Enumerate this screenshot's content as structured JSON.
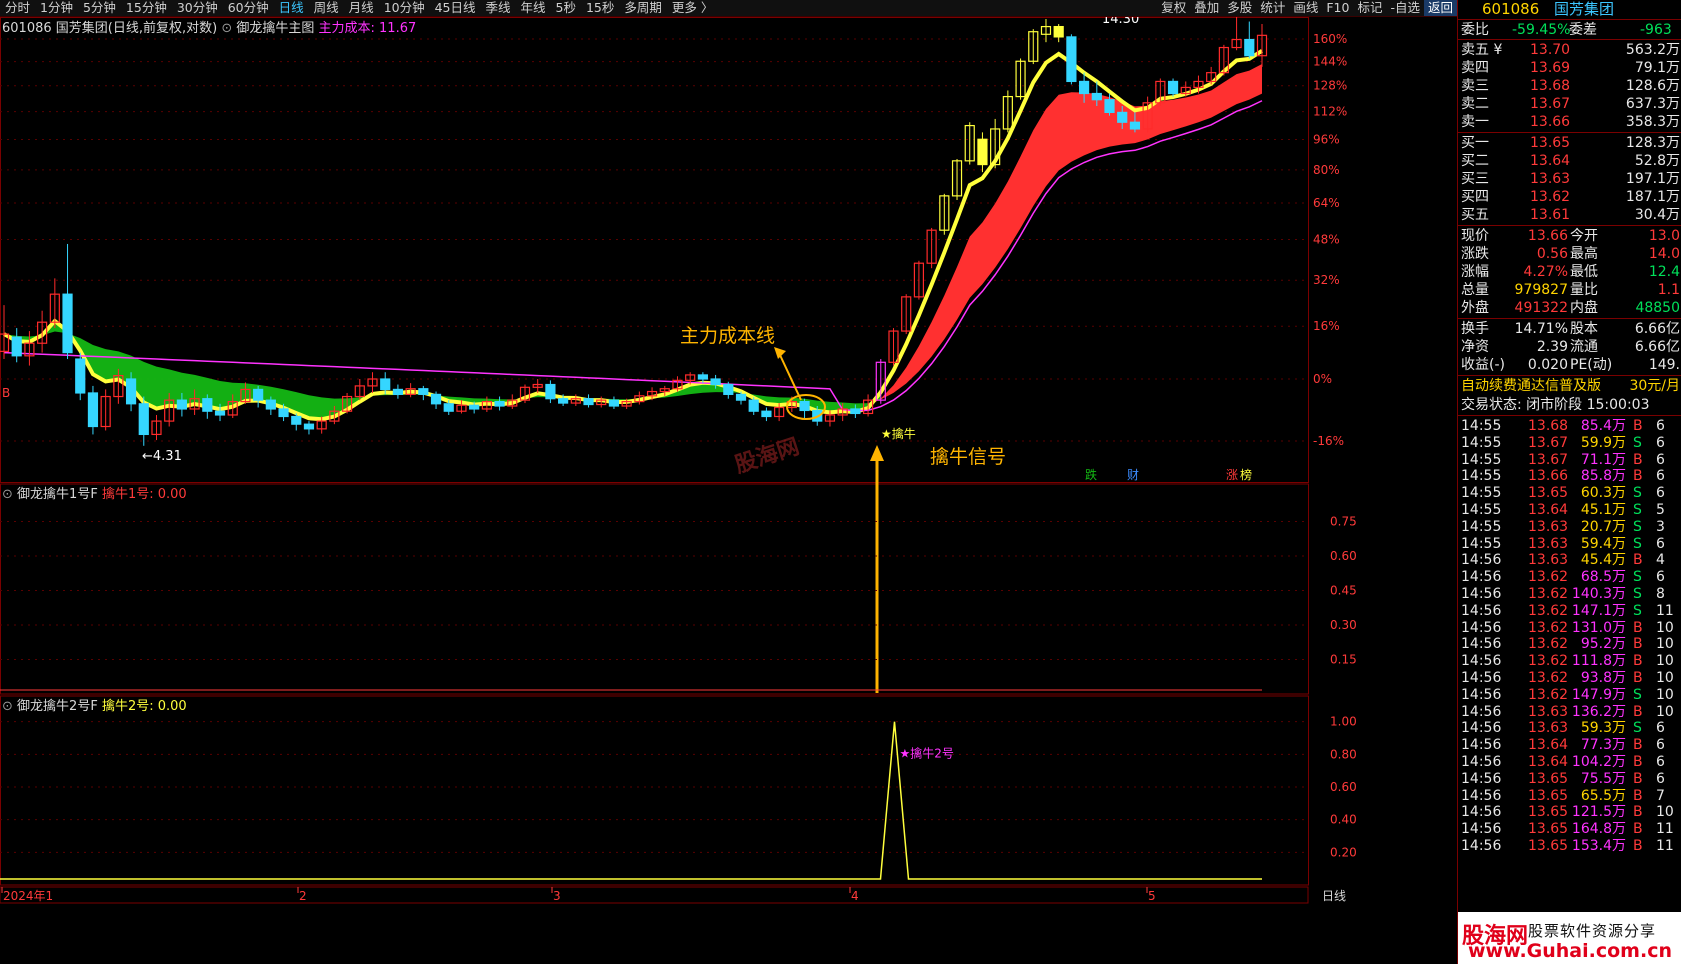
{
  "periods": [
    "分时",
    "1分钟",
    "5分钟",
    "15分钟",
    "30分钟",
    "60分钟",
    "日线",
    "周线",
    "月线",
    "10分钟",
    "45日线",
    "季线",
    "年线",
    "5秒",
    "15秒",
    "多周期",
    "更多 〉"
  ],
  "active_period": "日线",
  "tools": [
    "复权",
    "叠加",
    "多股",
    "统计",
    "画线",
    "F10",
    "标记",
    "-自选",
    "返回"
  ],
  "main_title": "601086 国芳集团(日线,前复权,对数)",
  "main_indicator": "御龙擒牛主图",
  "main_value": "主力成本: 11.67",
  "panel1_title": "御龙擒牛1号F",
  "panel1_value": "擒牛1号: 0.00",
  "panel2_title": "御龙擒牛2号F",
  "panel2_value": "擒牛2号: 0.00",
  "annotations": {
    "cost_line": "主力成本线",
    "signal": "擒牛信号",
    "qinniu": "★擒牛",
    "qinniu2": "★擒牛2号",
    "high": "14.30",
    "low": "4.31",
    "b_mark": "B",
    "watermark": "股海网",
    "die": "跌",
    "cai": "财",
    "zhang": "涨",
    "bang": "榜"
  },
  "x_axis": {
    "labels": [
      "2024年1",
      "2",
      "3",
      "4",
      "5"
    ],
    "period_label": "日线"
  },
  "colors": {
    "up": "#ff2b2b",
    "down": "#35d6ff",
    "yellow": "#ffff3c",
    "green": "#14b814",
    "magenta": "#ff33ff",
    "gold": "#ffb400"
  },
  "chart_data": [
    {
      "type": "candlestick",
      "title": "御龙擒牛主图",
      "y_scale": "log-percent",
      "y_ticks": [
        "160%",
        "144%",
        "128%",
        "112%",
        "96%",
        "80%",
        "64%",
        "48%",
        "32%",
        "16%",
        "0%",
        "-16%"
      ],
      "candles": [
        [
          0,
          5.62,
          5.9,
          6.4,
          5.5
        ],
        [
          1,
          5.85,
          5.55,
          6.0,
          5.45
        ],
        [
          2,
          5.55,
          5.75,
          5.95,
          5.4
        ],
        [
          3,
          5.75,
          6.1,
          6.3,
          5.6
        ],
        [
          4,
          6.1,
          6.6,
          6.9,
          6.0
        ],
        [
          5,
          6.6,
          5.6,
          7.6,
          5.5
        ],
        [
          6,
          5.5,
          5.0,
          5.6,
          4.9
        ],
        [
          7,
          5.0,
          4.55,
          5.1,
          4.45
        ],
        [
          8,
          4.55,
          4.95,
          5.05,
          4.5
        ],
        [
          9,
          4.95,
          5.25,
          5.35,
          4.85
        ],
        [
          10,
          5.2,
          4.85,
          5.3,
          4.75
        ],
        [
          11,
          4.85,
          4.45,
          4.95,
          4.31
        ],
        [
          12,
          4.45,
          4.62,
          4.7,
          4.38
        ],
        [
          13,
          4.62,
          4.9,
          5.0,
          4.55
        ],
        [
          14,
          4.9,
          4.78,
          5.0,
          4.68
        ],
        [
          15,
          4.78,
          4.92,
          5.05,
          4.7
        ],
        [
          16,
          4.92,
          4.75,
          4.98,
          4.65
        ],
        [
          17,
          4.75,
          4.7,
          4.85,
          4.62
        ],
        [
          18,
          4.7,
          4.88,
          4.98,
          4.66
        ],
        [
          19,
          4.88,
          5.05,
          5.15,
          4.85
        ],
        [
          20,
          5.05,
          4.9,
          5.1,
          4.8
        ],
        [
          21,
          4.9,
          4.78,
          4.95,
          4.7
        ],
        [
          22,
          4.78,
          4.68,
          4.85,
          4.62
        ],
        [
          23,
          4.68,
          4.58,
          4.72,
          4.5
        ],
        [
          24,
          4.58,
          4.52,
          4.62,
          4.45
        ],
        [
          25,
          4.52,
          4.62,
          4.68,
          4.46
        ],
        [
          26,
          4.62,
          4.75,
          4.82,
          4.58
        ],
        [
          27,
          4.75,
          4.95,
          5.0,
          4.72
        ],
        [
          28,
          4.95,
          5.1,
          5.2,
          4.9
        ],
        [
          29,
          5.1,
          5.2,
          5.3,
          5.0
        ],
        [
          30,
          5.2,
          5.05,
          5.3,
          4.98
        ],
        [
          31,
          5.05,
          4.98,
          5.12,
          4.92
        ],
        [
          32,
          4.98,
          5.06,
          5.14,
          4.94
        ],
        [
          33,
          5.06,
          4.98,
          5.1,
          4.9
        ],
        [
          34,
          4.98,
          4.85,
          5.02,
          4.78
        ],
        [
          35,
          4.85,
          4.75,
          4.9,
          4.7
        ],
        [
          36,
          4.75,
          4.83,
          4.9,
          4.72
        ],
        [
          37,
          4.83,
          4.78,
          4.88,
          4.72
        ],
        [
          38,
          4.78,
          4.88,
          4.95,
          4.74
        ],
        [
          39,
          4.88,
          4.82,
          4.95,
          4.76
        ],
        [
          40,
          4.82,
          4.9,
          4.98,
          4.78
        ],
        [
          41,
          4.9,
          5.08,
          5.12,
          4.86
        ],
        [
          42,
          5.08,
          5.12,
          5.2,
          5.0
        ],
        [
          43,
          5.12,
          4.92,
          5.18,
          4.86
        ],
        [
          44,
          4.92,
          4.86,
          4.98,
          4.82
        ],
        [
          45,
          4.86,
          4.92,
          4.98,
          4.82
        ],
        [
          46,
          4.92,
          4.84,
          4.98,
          4.8
        ],
        [
          47,
          4.84,
          4.9,
          4.95,
          4.8
        ],
        [
          48,
          4.9,
          4.82,
          4.95,
          4.78
        ],
        [
          49,
          4.82,
          4.88,
          4.92,
          4.78
        ],
        [
          50,
          4.88,
          4.96,
          5.02,
          4.84
        ],
        [
          51,
          4.96,
          5.02,
          5.08,
          4.9
        ],
        [
          52,
          5.02,
          5.06,
          5.1,
          4.96
        ],
        [
          53,
          5.06,
          5.18,
          5.24,
          5.02
        ],
        [
          54,
          5.18,
          5.26,
          5.3,
          5.12
        ],
        [
          55,
          5.26,
          5.2,
          5.3,
          5.14
        ],
        [
          56,
          5.2,
          5.12,
          5.26,
          5.06
        ],
        [
          57,
          5.12,
          4.98,
          5.16,
          4.92
        ],
        [
          58,
          4.98,
          4.9,
          5.02,
          4.84
        ],
        [
          59,
          4.9,
          4.75,
          4.94,
          4.7
        ],
        [
          60,
          4.75,
          4.68,
          4.8,
          4.62
        ],
        [
          61,
          4.68,
          4.8,
          4.86,
          4.62
        ],
        [
          62,
          4.8,
          4.88,
          4.95,
          4.74
        ],
        [
          63,
          4.88,
          4.76,
          4.92,
          4.66
        ],
        [
          64,
          4.76,
          4.62,
          4.82,
          4.56
        ],
        [
          65,
          4.62,
          4.7,
          4.76,
          4.55
        ],
        [
          66,
          4.7,
          4.78,
          4.86,
          4.62
        ],
        [
          67,
          4.78,
          4.72,
          4.84,
          4.66
        ],
        [
          68,
          4.72,
          4.9,
          4.98,
          4.68
        ],
        [
          69,
          4.9,
          5.45,
          5.5,
          4.85
        ],
        [
          70,
          5.45,
          5.95,
          6.0,
          5.4
        ],
        [
          71,
          5.95,
          6.55,
          6.6,
          5.9
        ],
        [
          72,
          6.55,
          7.2,
          7.25,
          6.5
        ],
        [
          73,
          7.2,
          7.9,
          7.95,
          7.1
        ],
        [
          74,
          7.9,
          8.7,
          8.75,
          7.8
        ],
        [
          75,
          8.7,
          9.6,
          9.65,
          8.6
        ],
        [
          76,
          9.6,
          10.6,
          10.7,
          9.5
        ],
        [
          77,
          10.2,
          9.5,
          10.4,
          9.3
        ],
        [
          78,
          9.5,
          10.5,
          10.8,
          9.4
        ],
        [
          79,
          10.5,
          11.5,
          11.7,
          10.4
        ],
        [
          80,
          11.5,
          12.7,
          12.8,
          11.4
        ],
        [
          81,
          12.7,
          13.8,
          13.9,
          12.6
        ],
        [
          82,
          13.7,
          14.0,
          14.3,
          13.4
        ],
        [
          83,
          14.0,
          13.6,
          14.1,
          13.4
        ],
        [
          84,
          13.6,
          12.0,
          13.7,
          11.9
        ],
        [
          85,
          12.0,
          11.6,
          12.3,
          11.3
        ],
        [
          86,
          11.6,
          11.4,
          12.0,
          11.2
        ],
        [
          87,
          11.4,
          11.0,
          11.6,
          10.9
        ],
        [
          88,
          11.0,
          10.7,
          11.2,
          10.5
        ],
        [
          89,
          10.7,
          10.5,
          11.0,
          10.4
        ],
        [
          90,
          10.5,
          11.3,
          11.5,
          10.4
        ],
        [
          91,
          11.3,
          12.0,
          12.1,
          11.2
        ],
        [
          92,
          12.0,
          11.6,
          12.1,
          11.5
        ],
        [
          93,
          11.6,
          11.8,
          12.0,
          11.5
        ],
        [
          94,
          11.8,
          12.0,
          12.2,
          11.6
        ],
        [
          95,
          12.0,
          12.3,
          12.5,
          11.9
        ],
        [
          96,
          12.3,
          13.2,
          13.3,
          12.2
        ],
        [
          97,
          13.2,
          13.5,
          14.8,
          13.1
        ],
        [
          98,
          13.5,
          12.9,
          14.2,
          12.8
        ],
        [
          99,
          12.9,
          13.66,
          14.1,
          12.5
        ]
      ],
      "series": [
        {
          "name": "主力成本",
          "color": "#ff33ff"
        }
      ]
    },
    {
      "type": "line",
      "title": "御龙擒牛1号F",
      "y_ticks": [
        "0.75",
        "0.60",
        "0.45",
        "0.30",
        "0.15"
      ],
      "ylim": [
        0,
        0.9
      ],
      "values": []
    },
    {
      "type": "line",
      "title": "御龙擒牛2号F",
      "y_ticks": [
        "1.00",
        "0.80",
        "0.60",
        "0.40",
        "0.20"
      ],
      "ylim": [
        0,
        1.2
      ],
      "spike_index": 70,
      "spike_value": 1.0
    }
  ],
  "quote": {
    "code": "601086",
    "name": "国芳集团",
    "weibi_label": "委比",
    "weibi": "-59.45%",
    "weicha_label": "委差",
    "weicha": "-963",
    "sell": [
      {
        "label": "卖五 ¥",
        "price": "13.70",
        "vol": "563.2万"
      },
      {
        "label": "卖四",
        "price": "13.69",
        "vol": "79.1万"
      },
      {
        "label": "卖三",
        "price": "13.68",
        "vol": "128.6万"
      },
      {
        "label": "卖二",
        "price": "13.67",
        "vol": "637.3万"
      },
      {
        "label": "卖一",
        "price": "13.66",
        "vol": "358.3万"
      }
    ],
    "buy": [
      {
        "label": "买一",
        "price": "13.65",
        "vol": "128.3万"
      },
      {
        "label": "买二",
        "price": "13.64",
        "vol": "52.8万"
      },
      {
        "label": "买三",
        "price": "13.63",
        "vol": "197.1万"
      },
      {
        "label": "买四",
        "price": "13.62",
        "vol": "187.1万"
      },
      {
        "label": "买五",
        "price": "13.61",
        "vol": "30.4万"
      }
    ],
    "stats": [
      {
        "l1": "现价",
        "v1": "13.66",
        "c1": "red",
        "l2": "今开",
        "v2": "13.0",
        "c2": "red"
      },
      {
        "l1": "涨跌",
        "v1": "0.56",
        "c1": "red",
        "l2": "最高",
        "v2": "14.0",
        "c2": "red"
      },
      {
        "l1": "涨幅",
        "v1": "4.27%",
        "c1": "red",
        "l2": "最低",
        "v2": "12.4",
        "c2": "green"
      },
      {
        "l1": "总量",
        "v1": "979827",
        "c1": "yellow",
        "l2": "量比",
        "v2": "1.1",
        "c2": "red"
      },
      {
        "l1": "外盘",
        "v1": "491322",
        "c1": "red",
        "l2": "内盘",
        "v2": "48850",
        "c2": "green"
      }
    ],
    "stats2": [
      {
        "l1": "换手",
        "v1": "14.71%",
        "l2": "股本",
        "v2": "6.66亿"
      },
      {
        "l1": "净资",
        "v1": "2.39",
        "l2": "流通",
        "v2": "6.66亿"
      },
      {
        "l1": "收益(-)",
        "v1": "0.020",
        "l2": "PE(动)",
        "v2": "149."
      }
    ],
    "promo": "自动续费通达信普及版",
    "promo_price": "30元/月",
    "status": "交易状态: 闭市阶段 15:00:03",
    "ticks": [
      [
        "14:55",
        "13.68",
        "85.4万",
        "B",
        "6",
        "red",
        "mag"
      ],
      [
        "14:55",
        "13.67",
        "59.9万",
        "S",
        "6",
        "red",
        "yellow"
      ],
      [
        "14:55",
        "13.67",
        "71.1万",
        "B",
        "6",
        "red",
        "mag"
      ],
      [
        "14:55",
        "13.66",
        "85.8万",
        "B",
        "6",
        "red",
        "mag"
      ],
      [
        "14:55",
        "13.65",
        "60.3万",
        "S",
        "6",
        "red",
        "yellow"
      ],
      [
        "14:55",
        "13.64",
        "45.1万",
        "S",
        "5",
        "red",
        "yellow"
      ],
      [
        "14:55",
        "13.63",
        "20.7万",
        "S",
        "3",
        "red",
        "yellow"
      ],
      [
        "14:55",
        "13.63",
        "59.4万",
        "S",
        "6",
        "red",
        "yellow"
      ],
      [
        "14:56",
        "13.63",
        "45.4万",
        "B",
        "4",
        "red",
        "yellow"
      ],
      [
        "14:56",
        "13.62",
        "68.5万",
        "S",
        "6",
        "red",
        "mag"
      ],
      [
        "14:56",
        "13.62",
        "140.3万",
        "S",
        "8",
        "red",
        "mag"
      ],
      [
        "14:56",
        "13.62",
        "147.1万",
        "S",
        "11",
        "red",
        "mag"
      ],
      [
        "14:56",
        "13.62",
        "131.0万",
        "B",
        "10",
        "red",
        "mag"
      ],
      [
        "14:56",
        "13.62",
        "95.2万",
        "B",
        "10",
        "red",
        "mag"
      ],
      [
        "14:56",
        "13.62",
        "111.8万",
        "B",
        "10",
        "red",
        "mag"
      ],
      [
        "14:56",
        "13.62",
        "93.8万",
        "B",
        "10",
        "red",
        "mag"
      ],
      [
        "14:56",
        "13.62",
        "147.9万",
        "S",
        "10",
        "red",
        "mag"
      ],
      [
        "14:56",
        "13.63",
        "136.2万",
        "B",
        "10",
        "red",
        "mag"
      ],
      [
        "14:56",
        "13.63",
        "59.3万",
        "S",
        "6",
        "red",
        "yellow"
      ],
      [
        "14:56",
        "13.64",
        "77.3万",
        "B",
        "6",
        "red",
        "mag"
      ],
      [
        "14:56",
        "13.64",
        "104.2万",
        "B",
        "6",
        "red",
        "mag"
      ],
      [
        "14:56",
        "13.65",
        "75.5万",
        "B",
        "6",
        "red",
        "mag"
      ],
      [
        "14:56",
        "13.65",
        "65.5万",
        "B",
        "7",
        "red",
        "yellow"
      ],
      [
        "14:56",
        "13.65",
        "121.5万",
        "B",
        "10",
        "red",
        "mag"
      ],
      [
        "14:56",
        "13.65",
        "164.8万",
        "B",
        "11",
        "red",
        "mag"
      ],
      [
        "14:56",
        "13.65",
        "153.4万",
        "B",
        "11",
        "red",
        "mag"
      ]
    ],
    "logo_text": "股海网",
    "logo_sub": "股票软件资源分享",
    "logo_url": "www.Guhai.com.cn"
  }
}
